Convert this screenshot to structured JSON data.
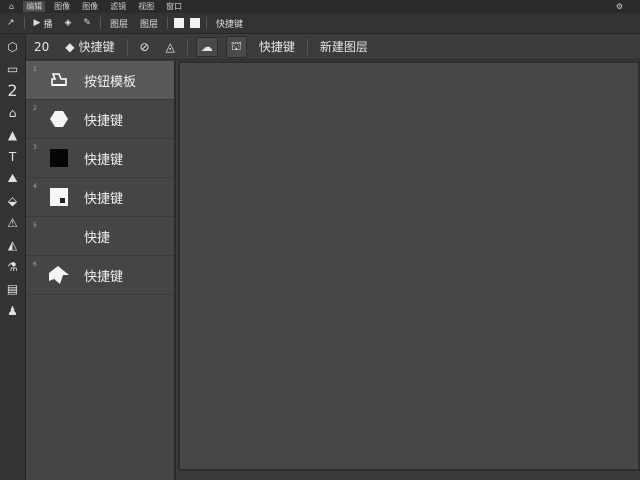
{
  "menubar": {
    "items": [
      "编辑",
      "图像",
      "图像",
      "滤镜",
      "视图",
      "窗口"
    ],
    "right_icon": "settings-icon"
  },
  "toolbar1": {
    "play_label": "播",
    "item2": "图层",
    "item3": "快捷键"
  },
  "toolbar2": {
    "size_value": "20",
    "mode_label": "快捷键",
    "tab_a": "快捷键",
    "tab_b": "新建图层"
  },
  "panel": {
    "items": [
      {
        "num": "1",
        "label": "按钮模板",
        "icon": "stamp-icon",
        "selected": true
      },
      {
        "num": "2",
        "label": "快捷键",
        "icon": "hexagon-shape-icon",
        "selected": false
      },
      {
        "num": "3",
        "label": "快捷键",
        "icon": "black-square-icon",
        "selected": false
      },
      {
        "num": "4",
        "label": "快捷键",
        "icon": "white-square-icon",
        "selected": false
      },
      {
        "num": "5",
        "label": "快捷",
        "icon": "",
        "selected": false
      },
      {
        "num": "6",
        "label": "快捷键",
        "icon": "arrow-shape-icon",
        "selected": false
      }
    ]
  },
  "colors": {
    "bg": "#3a3a3a",
    "canvas": "#474747",
    "panel": "#454545",
    "selected": "#585858"
  }
}
